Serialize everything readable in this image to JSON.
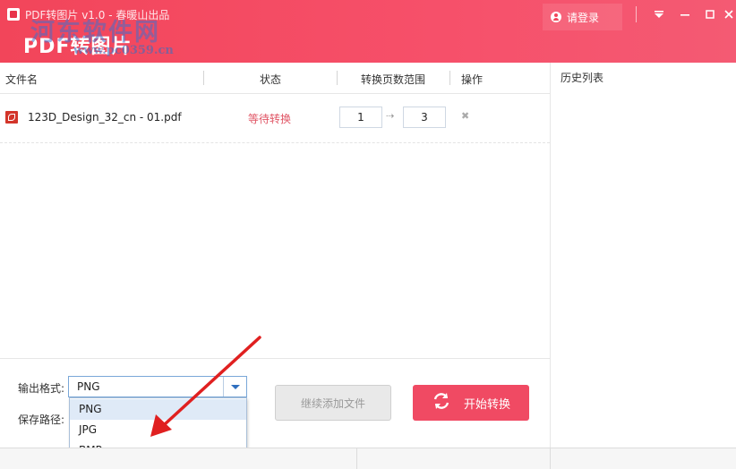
{
  "window": {
    "title": "PDF转图片 v1.0 - 春暖山出品",
    "brand": "PDF转图片",
    "watermark": "河东软件网",
    "watermark_url": "www.pc0359.cn",
    "login_label": "请登录"
  },
  "controls": {
    "menu": "▼",
    "minimize": "—",
    "maximize": "□",
    "close": "✕"
  },
  "table": {
    "headers": {
      "filename": "文件名",
      "status": "状态",
      "range": "转换页数范围",
      "action": "操作"
    },
    "rows": [
      {
        "filename": "123D_Design_32_cn - 01.pdf",
        "status": "等待转换",
        "range_from": "1",
        "range_to": "3",
        "arrow": "⇢",
        "delete": "✖"
      }
    ]
  },
  "history": {
    "title": "历史列表"
  },
  "output": {
    "format_label": "输出格式:",
    "format_value": "PNG",
    "format_options": [
      "PNG",
      "JPG",
      "BMP"
    ],
    "save_label": "保存路径:"
  },
  "buttons": {
    "add_files": "继续添加文件",
    "start": "开始转换"
  },
  "colors": {
    "brand_red": "#f2455a",
    "start_button": "#f04a63",
    "status_text": "#e05565",
    "annotation_arrow": "#e02020"
  },
  "icons": {
    "user": "user-icon",
    "pdf": "pdf-file-icon",
    "refresh": "refresh-icon",
    "dropdown": "chevron-down-icon"
  }
}
